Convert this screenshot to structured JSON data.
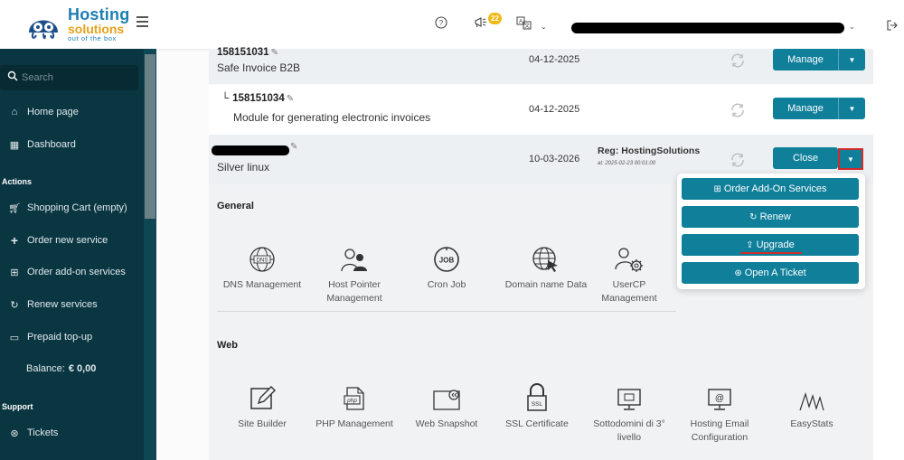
{
  "brand": {
    "name_line1": "Hosting",
    "name_line2": "solutions",
    "tagline": "out of the box",
    "colors": {
      "primary": "#1b7fb3",
      "accent": "#e6a118",
      "sidebar": "#0a3642",
      "button": "#0f7f9a",
      "highlight": "#d12b2b"
    }
  },
  "topbar": {
    "notifications_count": "22",
    "icons": [
      "help-circle-icon",
      "megaphone-icon",
      "translate-icon",
      "logout-icon"
    ],
    "user_name_redacted": true
  },
  "sidebar": {
    "search_placeholder": "Search",
    "items_top": [
      {
        "label": "Home page",
        "icon": "home-icon"
      },
      {
        "label": "Dashboard",
        "icon": "dashboard-icon"
      }
    ],
    "actions_title": "Actions",
    "actions": [
      {
        "label": "Shopping Cart (empty)",
        "icon": "cart-icon"
      },
      {
        "label": "Order new service",
        "icon": "plus-icon"
      },
      {
        "label": "Order add-on services",
        "icon": "plus-square-icon"
      },
      {
        "label": "Renew services",
        "icon": "refresh-icon"
      },
      {
        "label": "Prepaid top-up",
        "icon": "money-icon"
      }
    ],
    "balance_label": "Balance:",
    "balance_value": "€ 0,00",
    "support_title": "Support",
    "support": [
      {
        "label": "Tickets",
        "icon": "support-icon"
      }
    ]
  },
  "services": [
    {
      "id": "158151031",
      "name": "Safe Invoice B2B",
      "date": "04-12-2025",
      "button": "Manage"
    },
    {
      "id": "158151034",
      "name": "Module for generating electronic invoices",
      "date": "04-12-2025",
      "button": "Manage",
      "child_marker": "└"
    },
    {
      "id_redacted": true,
      "name": "Silver linux",
      "date": "10-03-2026",
      "reg_label": "Reg: HostingSolutions",
      "reg_at": "at: 2025-02-23 00:01:00",
      "button": "Close"
    }
  ],
  "details": {
    "general_title": "General",
    "general_tiles": [
      {
        "label": "DNS Management",
        "icon": "dns-globe-icon"
      },
      {
        "label": "Host Pointer Management",
        "icon": "user-group-icon"
      },
      {
        "label": "Cron Job",
        "icon": "job-icon"
      },
      {
        "label": "Domain name Data",
        "icon": "globe-cursor-icon"
      },
      {
        "label": "UserCP Management",
        "icon": "user-gear-icon"
      }
    ],
    "web_title": "Web",
    "web_tiles": [
      {
        "label": "Site Builder",
        "icon": "edit-square-icon"
      },
      {
        "label": "PHP Management",
        "icon": "php-file-icon"
      },
      {
        "label": "Web Snapshot",
        "icon": "snapshot-icon"
      },
      {
        "label": "SSL Certificate",
        "icon": "ssl-lock-icon"
      },
      {
        "label": "Sottodomini di 3° livello",
        "icon": "monitor-icon"
      },
      {
        "label": "Hosting Email Configuration",
        "icon": "email-monitor-icon"
      },
      {
        "label": "EasyStats",
        "icon": "stats-line-icon"
      }
    ]
  },
  "dropdown_menu": [
    {
      "label": "Order Add-On Services",
      "icon": "plus-square-icon"
    },
    {
      "label": "Renew",
      "icon": "refresh-icon"
    },
    {
      "label": "Upgrade",
      "icon": "upgrade-icon"
    },
    {
      "label": "Open A Ticket",
      "icon": "support-icon"
    }
  ]
}
